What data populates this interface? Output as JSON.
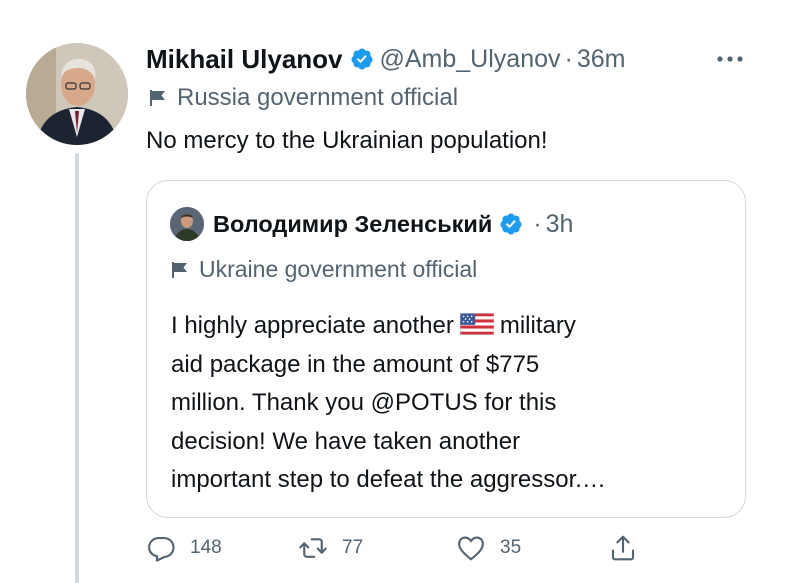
{
  "tweet": {
    "author_name": "Mikhail Ulyanov",
    "handle": "@Amb_Ulyanov",
    "separator": "·",
    "time": "36m",
    "label": "Russia government official",
    "text": "No mercy to the Ukrainian population!",
    "more_icon": "ellipsis-icon"
  },
  "quoted_tweet": {
    "author_name": "Володимир Зеленський",
    "separator": "·",
    "time": "3h",
    "label": "Ukraine government official",
    "text_lines": [
      "I highly appreciate another",
      "military",
      "aid package in the amount of $775",
      "million. Thank you @POTUS for this",
      "decision! We have taken another",
      "important step to defeat the aggressor.…"
    ]
  },
  "actions": {
    "reply_count": "148",
    "retweet_count": "77",
    "like_count": "35"
  },
  "colors": {
    "verified": "#1d9bf0",
    "secondary_text": "#536471",
    "border": "#cfd9de"
  }
}
